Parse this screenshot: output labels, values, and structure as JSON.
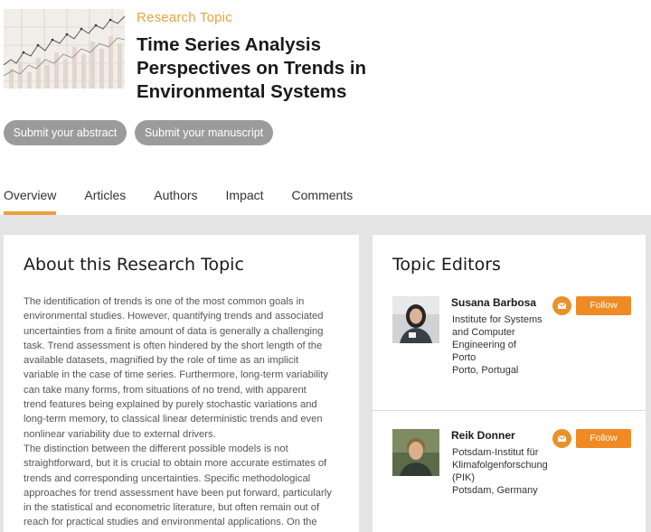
{
  "header": {
    "eyebrow": "Research Topic",
    "title_lines": [
      "Time Series Analysis",
      "Perspectives on Trends in",
      "Environmental Systems"
    ]
  },
  "actions": {
    "submit_abstract": "Submit your abstract",
    "submit_manuscript": "Submit your manuscript"
  },
  "tabs": [
    {
      "label": "Overview",
      "active": true
    },
    {
      "label": "Articles",
      "active": false
    },
    {
      "label": "Authors",
      "active": false
    },
    {
      "label": "Impact",
      "active": false
    },
    {
      "label": "Comments",
      "active": false
    }
  ],
  "about": {
    "heading": "About this Research Topic",
    "lines": [
      "The identification of trends is one of the most common goals in",
      "environmental studies. However, quantifying trends and associated",
      "uncertainties from a finite amount of data is generally a challenging",
      "task. Trend assessment is often hindered by the short length of the",
      "available datasets, magnified by the role of time as an implicit",
      "variable in the case of time series. Furthermore, long-term variability",
      "can take many forms, from situations of no trend, with apparent",
      "trend features being explained by purely stochastic variations and",
      "long-term memory, to classical linear deterministic trends and even",
      "nonlinear variability due to external drivers.",
      "The distinction between the different possible models is not",
      "straightforward, but it is crucial to obtain more accurate estimates of",
      "trends and corresponding uncertainties. Specific methodological",
      "approaches for trend assessment have been put forward, particularly",
      "in the statistical and econometric literature, but often remain out of",
      "reach for practical studies and environmental applications. On the"
    ]
  },
  "editors": {
    "heading": "Topic Editors",
    "follow_label": "Follow",
    "mail_icon": "envelope-icon",
    "accent": "#f08a24",
    "people": [
      {
        "name": "Susana Barbosa",
        "affiliation_lines": [
          "Institute for Systems",
          "and Computer",
          "Engineering of",
          "Porto",
          "Porto, Portugal"
        ]
      },
      {
        "name": "Reik Donner",
        "affiliation_lines": [
          "Potsdam-Institut für",
          "Klimafolgenforschung",
          "(PIK)",
          "Potsdam, Germany"
        ]
      }
    ]
  }
}
